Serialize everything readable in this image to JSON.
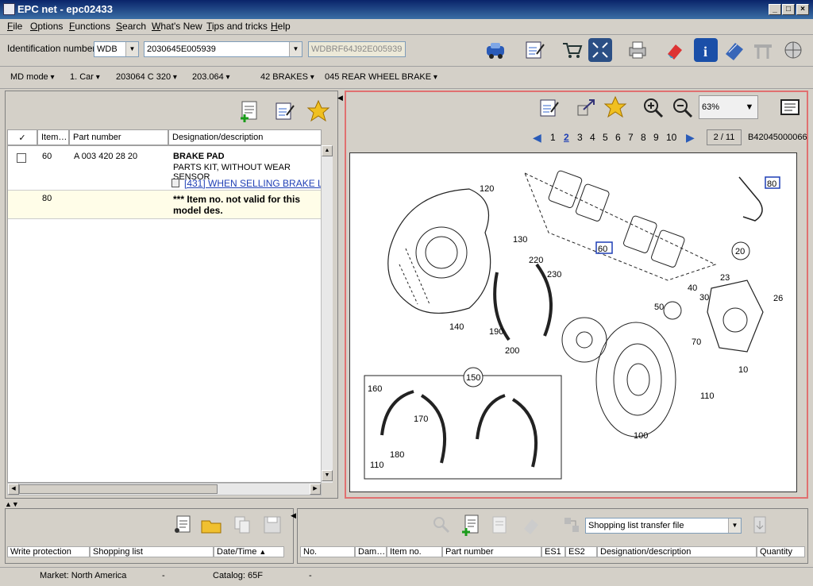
{
  "window": {
    "title": "EPC net - epc02433"
  },
  "menu": [
    "File",
    "Options",
    "Functions",
    "Search",
    "What's New",
    "Tips and tricks",
    "Help"
  ],
  "ident": {
    "label": "Identification number",
    "prefix": "WDB",
    "number": "2030645E005939",
    "vin": "WDBRF64J92E005939"
  },
  "mode": {
    "items": [
      "MD mode",
      "1. Car",
      "203064 C 320",
      "203.064",
      "42 BRAKES",
      "045 REAR WHEEL BRAKE"
    ]
  },
  "parts_table": {
    "headers": [
      "✓",
      "Item…",
      "Part number",
      "Designation/description"
    ],
    "rows": [
      {
        "item": "60",
        "part": "A 003 420 28 20",
        "desc1": "BRAKE PAD",
        "desc2": "PARTS KIT, WITHOUT WEAR SENSOR",
        "footnote": "[431] WHEN SELLING BRAKE L"
      },
      {
        "item": "80",
        "part": "",
        "desc1": "*** Item no. not valid for this model des."
      }
    ]
  },
  "viewer": {
    "zoom": "63%",
    "pages": [
      "1",
      "2",
      "3",
      "4",
      "5",
      "6",
      "7",
      "8",
      "9",
      "10"
    ],
    "active_page": "2",
    "page_of": "2 / 11",
    "image_id": "B42045000066"
  },
  "diagram_labels": {
    "l120": "120",
    "l130": "130",
    "l140": "140",
    "l190": "190",
    "l200": "200",
    "l220": "220",
    "l230": "230",
    "l60": "60",
    "l80": "80",
    "l20": "20",
    "l23": "23",
    "l26": "26",
    "l30": "30",
    "l40": "40",
    "l50": "50",
    "l70": "70",
    "l10": "10",
    "l110": "110",
    "l100": "100",
    "l150": "150",
    "l160": "160",
    "l170": "170",
    "l180": "180"
  },
  "bottom_left": {
    "headers": [
      "Write protection",
      "Shopping list",
      "Date/Time"
    ]
  },
  "bottom_right": {
    "select": "Shopping list transfer file",
    "headers": [
      "No.",
      "Dam…",
      "Item no.",
      "Part number",
      "ES1",
      "ES2",
      "Designation/description",
      "Quantity"
    ]
  },
  "status": {
    "market": "Market: North America",
    "sep1": "-",
    "catalog": "Catalog: 65F",
    "sep2": "-"
  }
}
